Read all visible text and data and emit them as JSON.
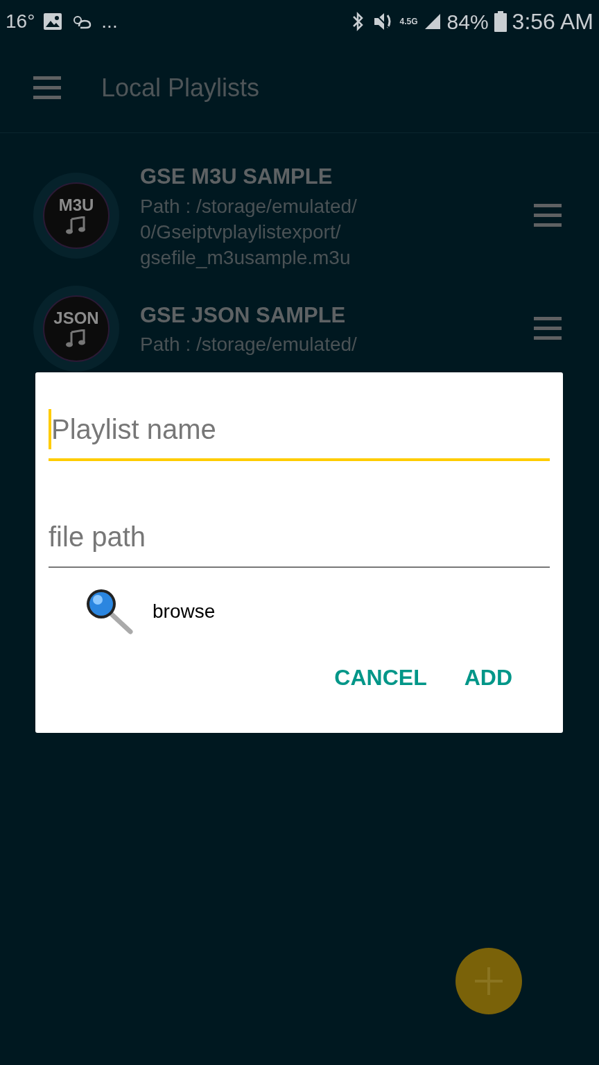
{
  "status_bar": {
    "temperature": "16°",
    "more": "...",
    "network": "4.5G",
    "battery": "84%",
    "time": "3:56 AM"
  },
  "toolbar": {
    "title": "Local Playlists"
  },
  "playlists": [
    {
      "badge": "M3U",
      "name": "GSE M3U SAMPLE",
      "path_lines": [
        "Path : /storage/emulated/",
        "0/Gseiptvplaylistexport/",
        "gsefile_m3usample.m3u"
      ]
    },
    {
      "badge": "JSON",
      "name": "GSE JSON SAMPLE",
      "path_lines": [
        "Path : /storage/emulated/"
      ]
    }
  ],
  "dialog": {
    "fields": [
      {
        "placeholder": "Playlist name",
        "focused": true
      },
      {
        "placeholder": "file path",
        "focused": false
      }
    ],
    "browse": "browse",
    "buttons": [
      "CANCEL",
      "ADD"
    ]
  }
}
